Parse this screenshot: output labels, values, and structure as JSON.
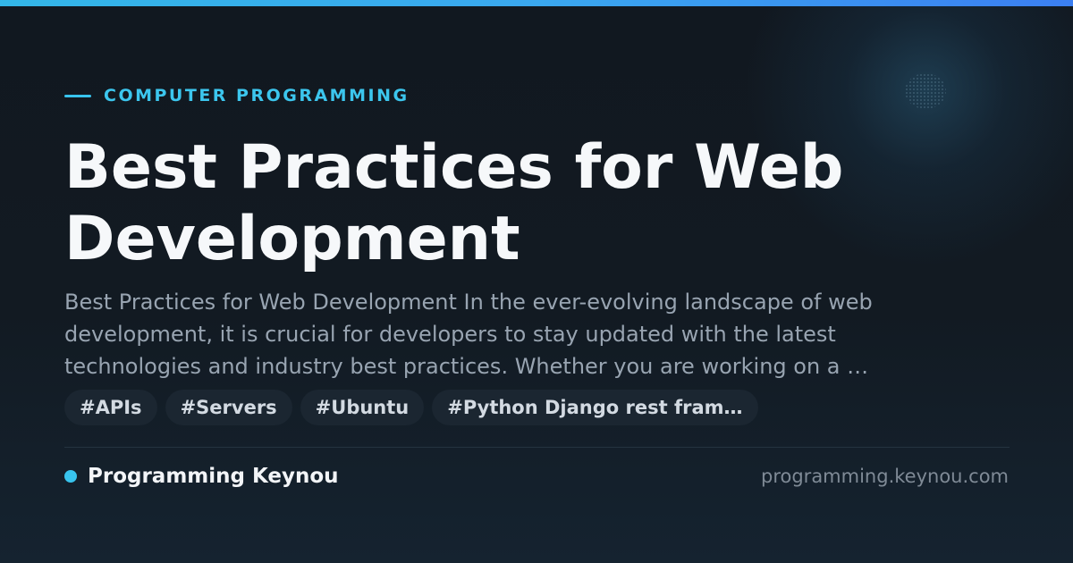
{
  "category": {
    "label": "COMPUTER PROGRAMMING"
  },
  "article": {
    "title": "Best Practices for Web Development",
    "excerpt": "Best Practices for Web Development In the ever-evolving landscape of web development, it is crucial for developers to stay updated with the latest technologies and industry best practices. Whether you are working on a …"
  },
  "tags": [
    "#APIs",
    "#Servers",
    "#Ubuntu",
    "#Python Django rest fram…"
  ],
  "footer": {
    "brand": "Programming Keynou",
    "url": "programming.keynou.com"
  },
  "colors": {
    "accent": "#38c4ee",
    "gradient_start": "#33b6e8",
    "gradient_end": "#3b7ff2",
    "background": "#121a22",
    "title": "#f6f8fa",
    "excerpt": "#98a4b1",
    "tag_background": "#1b2631"
  }
}
